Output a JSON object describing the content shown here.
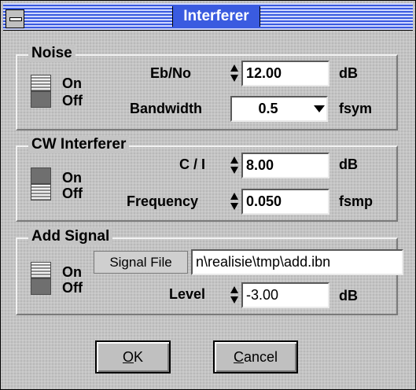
{
  "window": {
    "title": "Interferer"
  },
  "noise": {
    "group_title": "Noise",
    "toggle": {
      "on_label": "On",
      "off_label": "Off",
      "state": "off"
    },
    "ebno_label": "Eb/No",
    "ebno_value": "12.00",
    "ebno_unit": "dB",
    "bandwidth_label": "Bandwidth",
    "bandwidth_value": "0.5",
    "bandwidth_unit": "fsym"
  },
  "cw": {
    "group_title": "CW Interferer",
    "toggle": {
      "on_label": "On",
      "off_label": "Off",
      "state": "off"
    },
    "ci_label": "C / I",
    "ci_value": "8.00",
    "ci_unit": "dB",
    "freq_label": "Frequency",
    "freq_value": "0.050",
    "freq_unit": "fsmp"
  },
  "add_signal": {
    "group_title": "Add Signal",
    "toggle": {
      "on_label": "On",
      "off_label": "Off",
      "state": "off"
    },
    "file_label": "Signal File",
    "file_value": "n\\realisie\\tmp\\add.ibn",
    "level_label": "Level",
    "level_value": "-3.00",
    "level_unit": "dB"
  },
  "buttons": {
    "ok_mnemonic": "O",
    "ok_rest": "K",
    "cancel_mnemonic": "C",
    "cancel_rest": "ancel"
  },
  "colors": {
    "title_bar": "#3a5be0",
    "title_text": "#ffffff",
    "dialog_bg": "#c4c4c4"
  }
}
